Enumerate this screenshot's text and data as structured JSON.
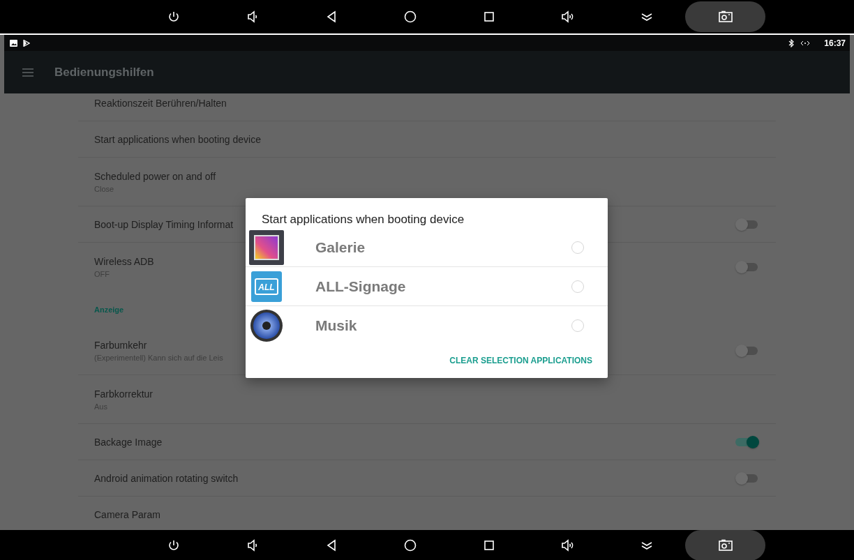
{
  "status_bar": {
    "time": "16:37"
  },
  "app_bar": {
    "title": "Bedienungshilfen"
  },
  "settings": [
    {
      "kind": "plain",
      "title": "Reaktionszeit Berühren/Halten"
    },
    {
      "kind": "plain",
      "title": "Start applications when booting device"
    },
    {
      "kind": "plain",
      "title": "Scheduled power on and off",
      "summary": "Close"
    },
    {
      "kind": "switch",
      "title": "Boot-up Display Timing Informat",
      "on": false
    },
    {
      "kind": "switch",
      "title": "Wireless ADB",
      "summary": "OFF",
      "on": false
    },
    {
      "kind": "header",
      "title": "Anzeige"
    },
    {
      "kind": "switch",
      "title": "Farbumkehr",
      "summary": "(Experimentell) Kann sich auf die Leis",
      "on": false
    },
    {
      "kind": "plain",
      "title": "Farbkorrektur",
      "summary": "Aus"
    },
    {
      "kind": "switch",
      "title": "Backage Image",
      "on": true
    },
    {
      "kind": "switch",
      "title": "Android animation rotating switch",
      "on": false
    },
    {
      "kind": "plain",
      "title": "Camera Param"
    }
  ],
  "dialog": {
    "title": "Start applications when booting device",
    "apps": [
      {
        "name": "Galerie",
        "selected": false
      },
      {
        "name": "ALL-Signage",
        "icon_text": "ALL",
        "selected": false
      },
      {
        "name": "Musik",
        "selected": false
      }
    ],
    "action": "CLEAR SELECTION APPLICATIONS"
  }
}
